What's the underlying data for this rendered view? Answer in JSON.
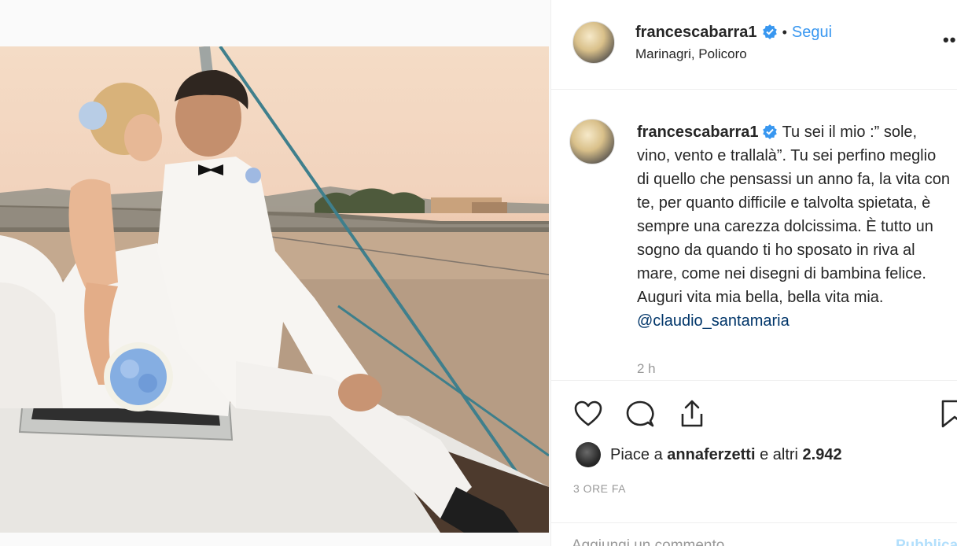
{
  "post": {
    "username": "francescabarra1",
    "follow_label": "Segui",
    "separator": "•",
    "location": "Marinagri, Policoro",
    "more_label": "••",
    "caption": {
      "username": "francescabarra1",
      "text": "Tu sei il mio :” sole, vino, vento e trallalà”. Tu sei perfino meglio di quello che pensassi un anno fa, la vita con te, per quanto difficile e talvolta spietata, è sempre una carezza dolcissima. È tutto un sogno da quando ti ho sposato in riva al mare, come nei disegni di bambina felice. Auguri vita mia bella, bella vita mia.",
      "mention": "@claudio_santamaria",
      "time": "2 h"
    },
    "likes": {
      "prefix": "Piace a ",
      "user": "annaferzetti",
      "suffix": " e altri ",
      "count": "2.942"
    },
    "time_ago": "3 ORE FA",
    "comment": {
      "placeholder": "Aggiungi un commento...",
      "publish_label": "Pubblica"
    }
  },
  "colors": {
    "link_blue": "#3897f0",
    "verified_blue": "#3897f0",
    "text": "#262626",
    "muted": "#999999"
  },
  "icons": [
    "verified-badge-icon",
    "heart-icon",
    "comment-icon",
    "share-icon",
    "bookmark-icon",
    "more-options-icon"
  ]
}
